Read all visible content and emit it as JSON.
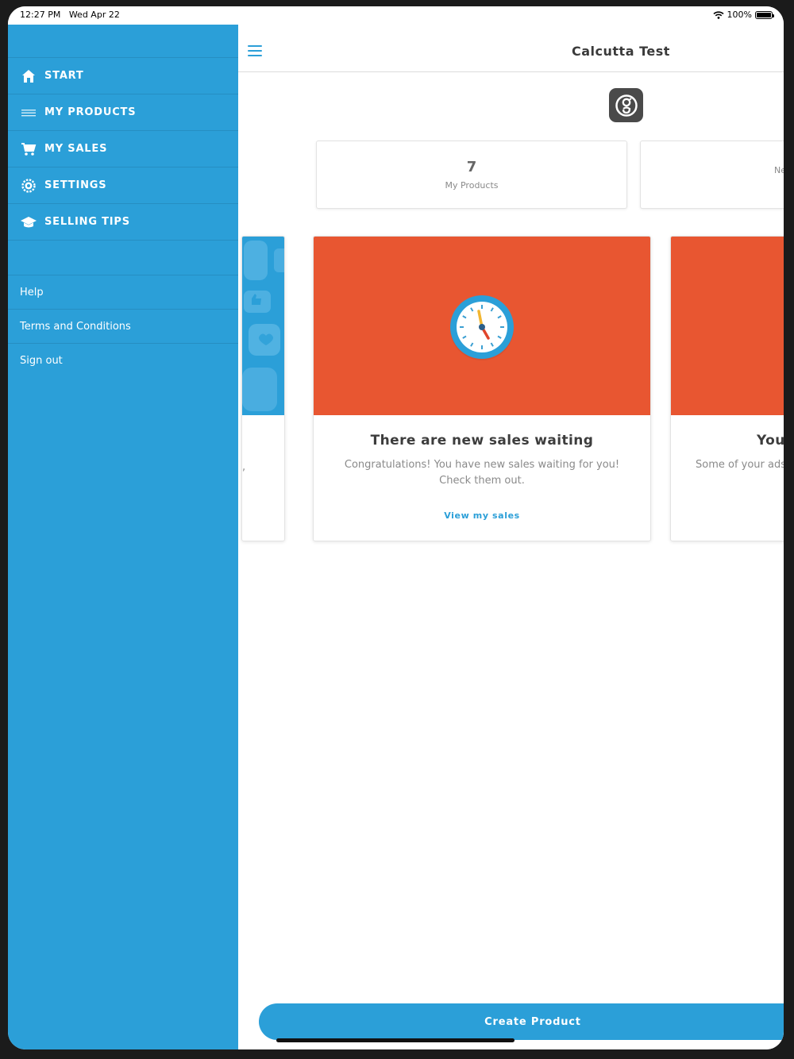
{
  "status": {
    "time": "12:27 PM",
    "date": "Wed Apr 22",
    "battery": "100%"
  },
  "sidebar": {
    "items": [
      {
        "label": "START",
        "icon": "home-icon"
      },
      {
        "label": "MY PRODUCTS",
        "icon": "list-icon"
      },
      {
        "label": "MY SALES",
        "icon": "cart-icon"
      },
      {
        "label": "SETTINGS",
        "icon": "gear-icon"
      },
      {
        "label": "SELLING TIPS",
        "icon": "graduation-cap-icon"
      }
    ],
    "links": [
      "Help",
      "Terms and Conditions",
      "Sign out"
    ]
  },
  "header": {
    "title": "Calcutta Test",
    "menu_icon": "hamburger-icon",
    "logo_icon": "g-logo-icon"
  },
  "stats": [
    {
      "value": "7",
      "label": "My Products"
    },
    {
      "value": "",
      "label": "New"
    }
  ],
  "cards": {
    "left": {
      "text": ","
    },
    "main": {
      "title": "There are new sales waiting",
      "text": "Congratulations! You have new sales waiting for you! Check them out.",
      "link": "View my sales",
      "icon": "clock-icon"
    },
    "right": {
      "title": "You",
      "text": "Some of your ads h"
    }
  },
  "actions": {
    "create_label": "Create Product"
  },
  "colors": {
    "primary": "#2b9fd8",
    "card_orange": "#e85631",
    "sidebar": "#2b9fd8"
  }
}
